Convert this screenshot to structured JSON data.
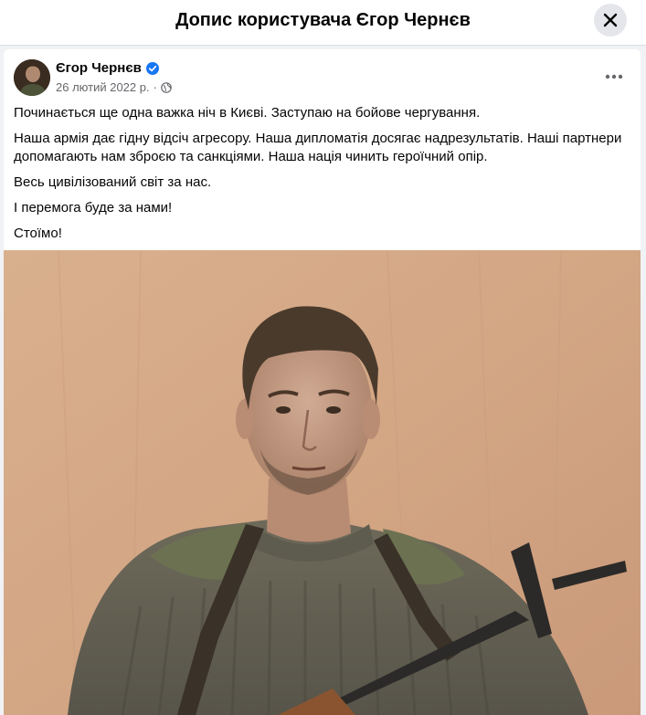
{
  "dialog": {
    "title": "Допис користувача Єгор Чернєв",
    "close_icon": "close-icon"
  },
  "post": {
    "author": "Єгор Чернєв",
    "verified_icon": "verified-badge-icon",
    "date": "26 лютий 2022 р.",
    "separator": "·",
    "audience_icon": "globe-icon",
    "more_icon": "more-horizontal-icon",
    "paragraphs": [
      "Починається ще одна важка ніч в Києві. Заступаю на бойове чергування.",
      "Наша армія дає гідну відсіч агресору. Наша дипломатія досягає надрезультатів. Наші партнери допомагають нам зброєю та санкціями. Наша нація чинить героїчний опір.",
      "Весь цивілізований світ за нас.",
      "І перемога буде за нами!",
      "Стоїмо!"
    ]
  },
  "colors": {
    "accent": "#1877f2",
    "text_primary": "#050505",
    "text_secondary": "#65676b",
    "page_bg": "#f0f2f5"
  }
}
